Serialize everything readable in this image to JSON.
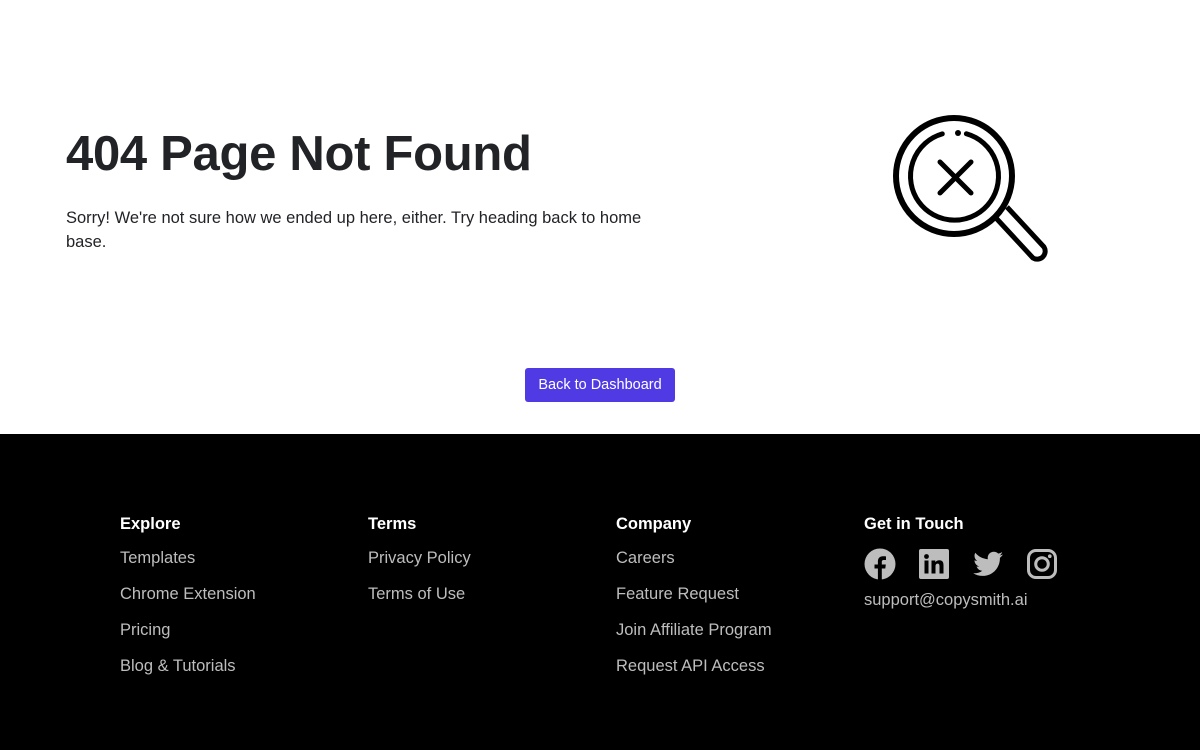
{
  "main": {
    "title": "404 Page Not Found",
    "description": "Sorry! We're not sure how we ended up here, either. Try heading back to home base.",
    "illustration_icon": "magnifier-x-icon",
    "button_label": "Back to Dashboard"
  },
  "footer": {
    "columns": [
      {
        "heading": "Explore",
        "links": [
          "Templates",
          "Chrome Extension",
          "Pricing",
          "Blog & Tutorials"
        ]
      },
      {
        "heading": "Terms",
        "links": [
          "Privacy Policy",
          "Terms of Use"
        ]
      },
      {
        "heading": "Company",
        "links": [
          "Careers",
          "Feature Request",
          "Join Affiliate Program",
          "Request API Access"
        ]
      }
    ],
    "contact": {
      "heading": "Get in Touch",
      "socials": [
        "facebook-icon",
        "linkedin-icon",
        "twitter-icon",
        "instagram-icon"
      ],
      "email": "support@copysmith.ai"
    }
  },
  "colors": {
    "accent": "#4f3ae3",
    "footer_bg": "#000000",
    "footer_link": "#bdbdbd",
    "text": "#222327"
  }
}
